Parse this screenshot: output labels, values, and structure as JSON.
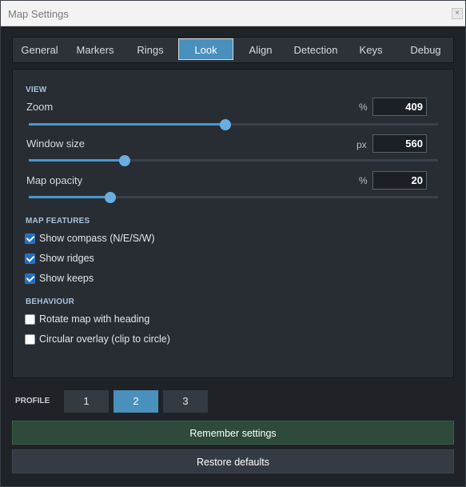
{
  "window": {
    "title": "Map Settings",
    "close_label": "×"
  },
  "tabs": [
    "General",
    "Markers",
    "Rings",
    "Look",
    "Align",
    "Detection",
    "Keys",
    "Debug"
  ],
  "active_tab": "Look",
  "sections": {
    "view": "VIEW",
    "map_features": "MAP FEATURES",
    "behaviour": "BEHAVIOUR"
  },
  "view": {
    "zoom": {
      "label": "Zoom",
      "unit": "%",
      "value": "409",
      "slider_fraction": 0.48
    },
    "window_size": {
      "label": "Window size",
      "unit": "px",
      "value": "560",
      "slider_fraction": 0.235
    },
    "map_opacity": {
      "label": "Map opacity",
      "unit": "%",
      "value": "20",
      "slider_fraction": 0.2
    }
  },
  "map_features": [
    {
      "label": "Show compass (N/E/S/W)",
      "checked": true
    },
    {
      "label": "Show ridges",
      "checked": true
    },
    {
      "label": "Show keeps",
      "checked": true
    }
  ],
  "behaviour": [
    {
      "label": "Rotate map with heading",
      "checked": false
    },
    {
      "label": "Circular overlay (clip to circle)",
      "checked": false
    }
  ],
  "profile": {
    "label": "PROFILE",
    "options": [
      "1",
      "2",
      "3"
    ],
    "selected": "2"
  },
  "buttons": {
    "remember": "Remember settings",
    "restore": "Restore defaults"
  },
  "colors": {
    "accent": "#4a90bd",
    "slider_fill": "#4b97c9",
    "checkbox_on": "#1f6ec2",
    "remember_bg": "#2d4a3a",
    "panel_bg": "#282d34"
  }
}
